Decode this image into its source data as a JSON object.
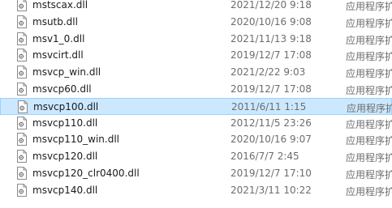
{
  "colors": {
    "selected_bg": "#cce8ff",
    "selected_border": "#99d1ff",
    "meta_text": "#6d6d6d"
  },
  "file_icon": "dll-file-icon",
  "files": [
    {
      "name": "mstscax.dll",
      "date": "2021/12/20 9:18",
      "type": "应用程序扩"
    },
    {
      "name": "msutb.dll",
      "date": "2020/10/16 9:08",
      "type": "应用程序扩"
    },
    {
      "name": "msv1_0.dll",
      "date": "2021/11/13 9:18",
      "type": "应用程序扩"
    },
    {
      "name": "msvcirt.dll",
      "date": "2019/12/7 17:08",
      "type": "应用程序扩"
    },
    {
      "name": "msvcp_win.dll",
      "date": "2021/2/22 9:03",
      "type": "应用程序扩"
    },
    {
      "name": "msvcp60.dll",
      "date": "2019/12/7 17:08",
      "type": "应用程序扩"
    },
    {
      "name": "msvcp100.dll",
      "date": "2011/6/11 1:15",
      "type": "应用程序扩",
      "selected": true
    },
    {
      "name": "msvcp110.dll",
      "date": "2012/11/5 23:26",
      "type": "应用程序扩"
    },
    {
      "name": "msvcp110_win.dll",
      "date": "2020/10/16 9:07",
      "type": "应用程序扩"
    },
    {
      "name": "msvcp120.dll",
      "date": "2016/7/7 2:45",
      "type": "应用程序扩"
    },
    {
      "name": "msvcp120_clr0400.dll",
      "date": "2019/12/7 17:10",
      "type": "应用程序扩"
    },
    {
      "name": "msvcp140.dll",
      "date": "2021/3/11 10:22",
      "type": "应用程序扩"
    }
  ]
}
